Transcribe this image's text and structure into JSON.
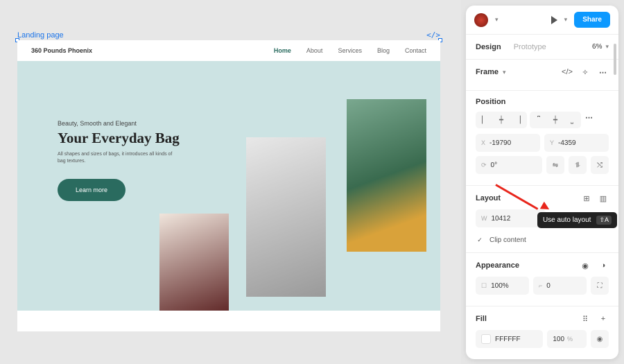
{
  "canvas": {
    "frame_label": "Landing page",
    "dev_icon": "</>"
  },
  "page": {
    "logo": "360 Pounds Phoenix",
    "nav": [
      "Home",
      "About",
      "Services",
      "Blog",
      "Contact"
    ],
    "nav_active_index": 0,
    "hero": {
      "kicker": "Beauty, Smooth and Elegant",
      "title": "Your Everyday Bag",
      "desc": "All shapes and sizes of bags, it introduces all kinds of bag textures.",
      "button": "Learn more"
    }
  },
  "panel": {
    "share": "Share",
    "tabs": {
      "design": "Design",
      "prototype": "Prototype"
    },
    "zoom": "6%",
    "frame_label": "Frame",
    "sections": {
      "position": {
        "title": "Position",
        "x": "-19790",
        "y": "-4359",
        "rotation": "0°"
      },
      "layout": {
        "title": "Layout",
        "w": "10412",
        "clip": "Clip content"
      },
      "appearance": {
        "title": "Appearance",
        "opacity": "100%",
        "radius": "0"
      },
      "fill": {
        "title": "Fill",
        "hex": "FFFFFF",
        "pct": "100",
        "unit": "%"
      }
    }
  },
  "tooltip": {
    "text": "Use auto layout",
    "shortcut": "⇧A"
  }
}
